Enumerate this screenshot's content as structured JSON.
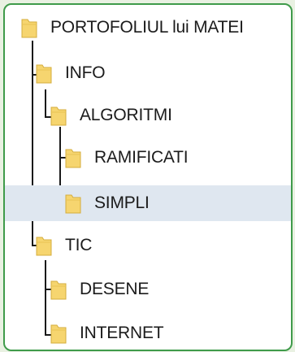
{
  "tree": {
    "root": {
      "label": "PORTOFOLIUL lui MATEI",
      "icon": "folder-icon"
    },
    "info": {
      "label": "INFO",
      "icon": "folder-icon"
    },
    "algoritmi": {
      "label": "ALGORITMI",
      "icon": "folder-icon"
    },
    "ramificati": {
      "label": "RAMIFICATI",
      "icon": "folder-icon"
    },
    "simpli": {
      "label": "SIMPLI",
      "icon": "folder-icon",
      "selected": true
    },
    "tic": {
      "label": "TIC",
      "icon": "folder-icon"
    },
    "desene": {
      "label": "DESENE",
      "icon": "folder-icon"
    },
    "internet": {
      "label": "INTERNET",
      "icon": "folder-icon"
    }
  },
  "colors": {
    "frame_border": "#3f9b4a",
    "outer_background": "#e9f1e2",
    "selected_row": "#dfe7f0",
    "folder_fill": "#f6d56f",
    "folder_edge": "#d4ad3d",
    "tree_line": "#1a1a1a"
  }
}
